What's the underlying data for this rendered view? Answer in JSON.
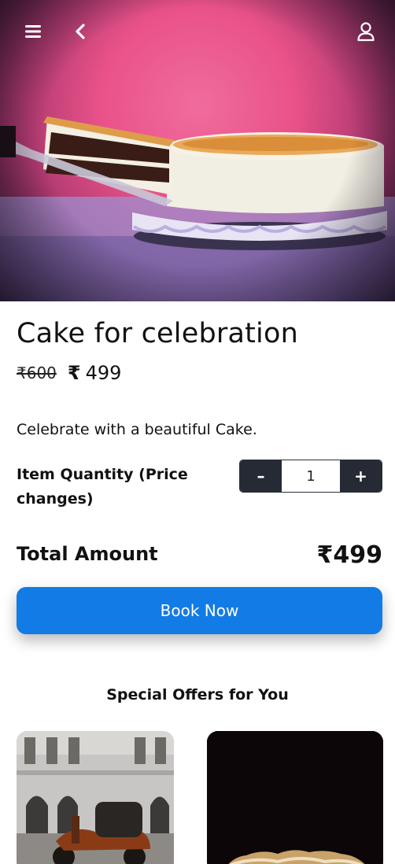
{
  "header": {
    "menu_icon": "hamburger-menu-icon",
    "back_icon": "chevron-left-icon",
    "profile_icon": "user-profile-icon"
  },
  "product": {
    "title": "Cake for celebration",
    "old_price": "₹600",
    "currency_symbol": "₹",
    "price": "499",
    "description": "Celebrate with a beautiful Cake."
  },
  "quantity": {
    "label": "Item Quantity (Price changes)",
    "decrement_label": "–",
    "increment_label": "+",
    "value": "1"
  },
  "total": {
    "label": "Total Amount",
    "value": "₹499"
  },
  "actions": {
    "book_label": "Book Now"
  },
  "offers": {
    "title": "Special Offers for You"
  },
  "colors": {
    "primary_button": "#137be5",
    "stepper_dark": "#252a35",
    "hero_pink": "#e95289"
  }
}
